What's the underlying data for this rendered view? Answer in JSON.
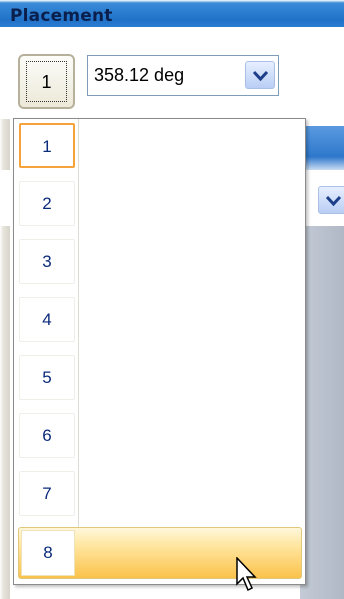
{
  "panel": {
    "title": "Placement"
  },
  "placement": {
    "selected_number": "1",
    "angle_value": "358.12 deg"
  },
  "dropdown": {
    "items": [
      "1",
      "2",
      "3",
      "4",
      "5",
      "6",
      "7",
      "8"
    ],
    "selected_index": 0,
    "hovered_index": 7
  },
  "icons": {
    "combo_arrow": "chevron-down-icon",
    "pointer": "mouse-pointer-icon"
  },
  "colors": {
    "header_blue": "#1f72c8",
    "selection_orange": "#f5a33a",
    "hover_yellow": "#fbc24a",
    "item_text": "#0a2a7a"
  }
}
